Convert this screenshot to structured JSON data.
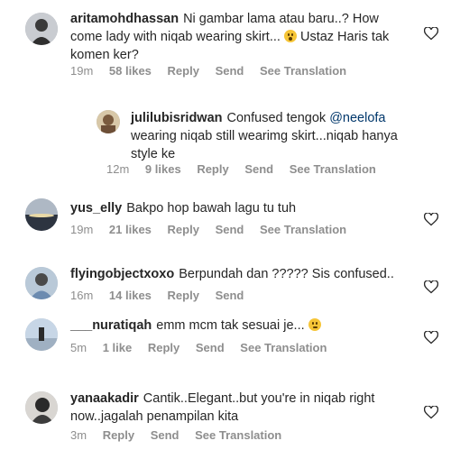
{
  "comments": [
    {
      "username": "aritamohdhassan",
      "text": "Ni gambar lama atau baru..? How come lady with niqab wearing skirt...",
      "text_after": "Ustaz Haris tak komen ker?",
      "emoji": "astonished-face",
      "time": "19m",
      "likes": "58 likes",
      "reply": "Reply",
      "send": "Send",
      "translate": "See Translation"
    },
    {
      "username": "julilubisridwan",
      "text_before": "Confused tengok",
      "mention": "@neelofa",
      "text": "wearing niqab still wearimg skirt...niqab hanya style ke",
      "time": "12m",
      "likes": "9 likes",
      "reply": "Reply",
      "send": "Send",
      "translate": "See Translation"
    },
    {
      "username": "yus_elly",
      "text": "Bakpo hop bawah lagu tu tuh",
      "time": "19m",
      "likes": "21 likes",
      "reply": "Reply",
      "send": "Send",
      "translate": "See Translation"
    },
    {
      "username": "flyingobjectxoxo",
      "text": "Berpundah dan ????? Sis confused..",
      "time": "16m",
      "likes": "14 likes",
      "reply": "Reply",
      "send": "Send"
    },
    {
      "username": "___nuratiqah",
      "text": "emm mcm tak sesuai je...",
      "emoji": "crying-face",
      "time": "5m",
      "likes": "1 like",
      "reply": "Reply",
      "send": "Send",
      "translate": "See Translation"
    },
    {
      "username": "yanaakadir",
      "text": "Cantik..Elegant..but you're in niqab right now..jagalah penampilan kita",
      "time": "3m",
      "reply": "Reply",
      "send": "Send",
      "translate": "See Translation"
    }
  ],
  "icons": {
    "like": "heart-outline-icon"
  }
}
